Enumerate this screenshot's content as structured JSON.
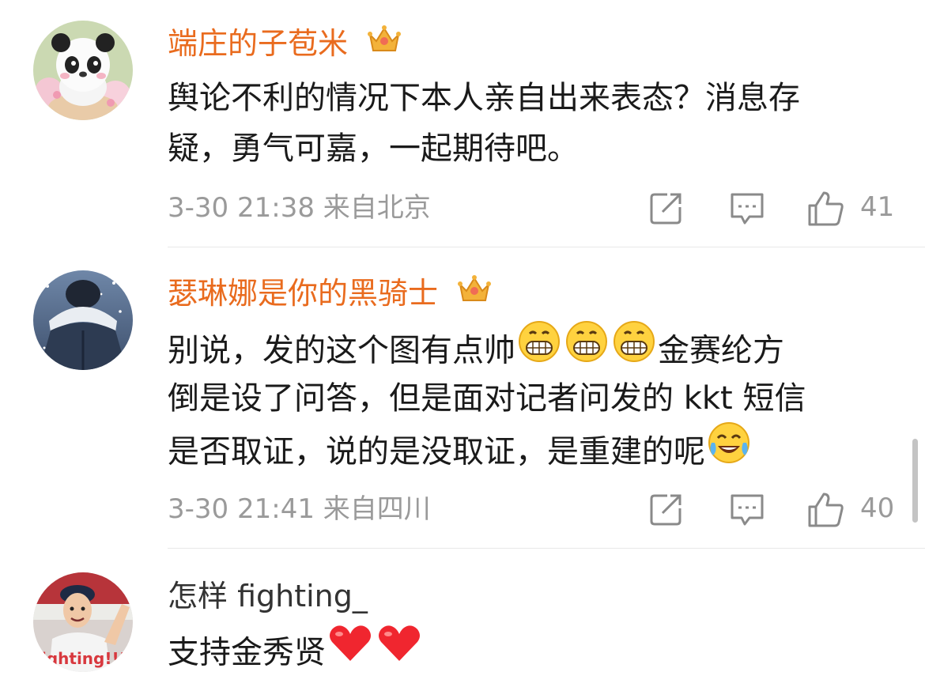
{
  "comments": [
    {
      "username": "端庄的子苞米",
      "username_style": "vip",
      "badge": "crown-badge-icon",
      "avatar": "panda-avatar",
      "lines": [
        [
          "舆论不利的情况下本人亲自出来表态？消息存"
        ],
        [
          "疑，勇气可嘉，一起期待吧。"
        ]
      ],
      "timestamp": "3-30 21:38",
      "location": "来自北京",
      "likes": "41"
    },
    {
      "username": "瑟琳娜是你的黑骑士",
      "username_style": "vip",
      "badge": "crown-badge-icon",
      "avatar": "snow-hooded-person-avatar",
      "lines": [
        [
          "别说，发的这个图有点帅",
          "grin-emoji",
          "grin-emoji",
          "grin-emoji",
          "金赛纶方"
        ],
        [
          "倒是设了问答，但是面对记者问发的 kkt 短信"
        ],
        [
          "是否取证，说的是没取证，是重建的呢",
          "tears-of-joy-emoji"
        ]
      ],
      "timestamp": "3-30 21:41",
      "location": "来自四川",
      "likes": "40"
    },
    {
      "username": "怎样 fighting_",
      "username_style": "normal",
      "avatar": "fighting-man-avatar",
      "avatar_text": "fighting!!!",
      "lines": [
        [
          "支持金秀贤",
          "heart-emoji",
          "heart-emoji"
        ]
      ]
    }
  ],
  "colors": {
    "vip_name": "#e96b1e",
    "normal_name": "#333333",
    "content": "#1a1a1a",
    "meta": "#9a9a9a",
    "divider": "#e8e8e8"
  },
  "icons": [
    "repost-icon",
    "comment-icon",
    "like-icon",
    "crown-badge-icon"
  ]
}
